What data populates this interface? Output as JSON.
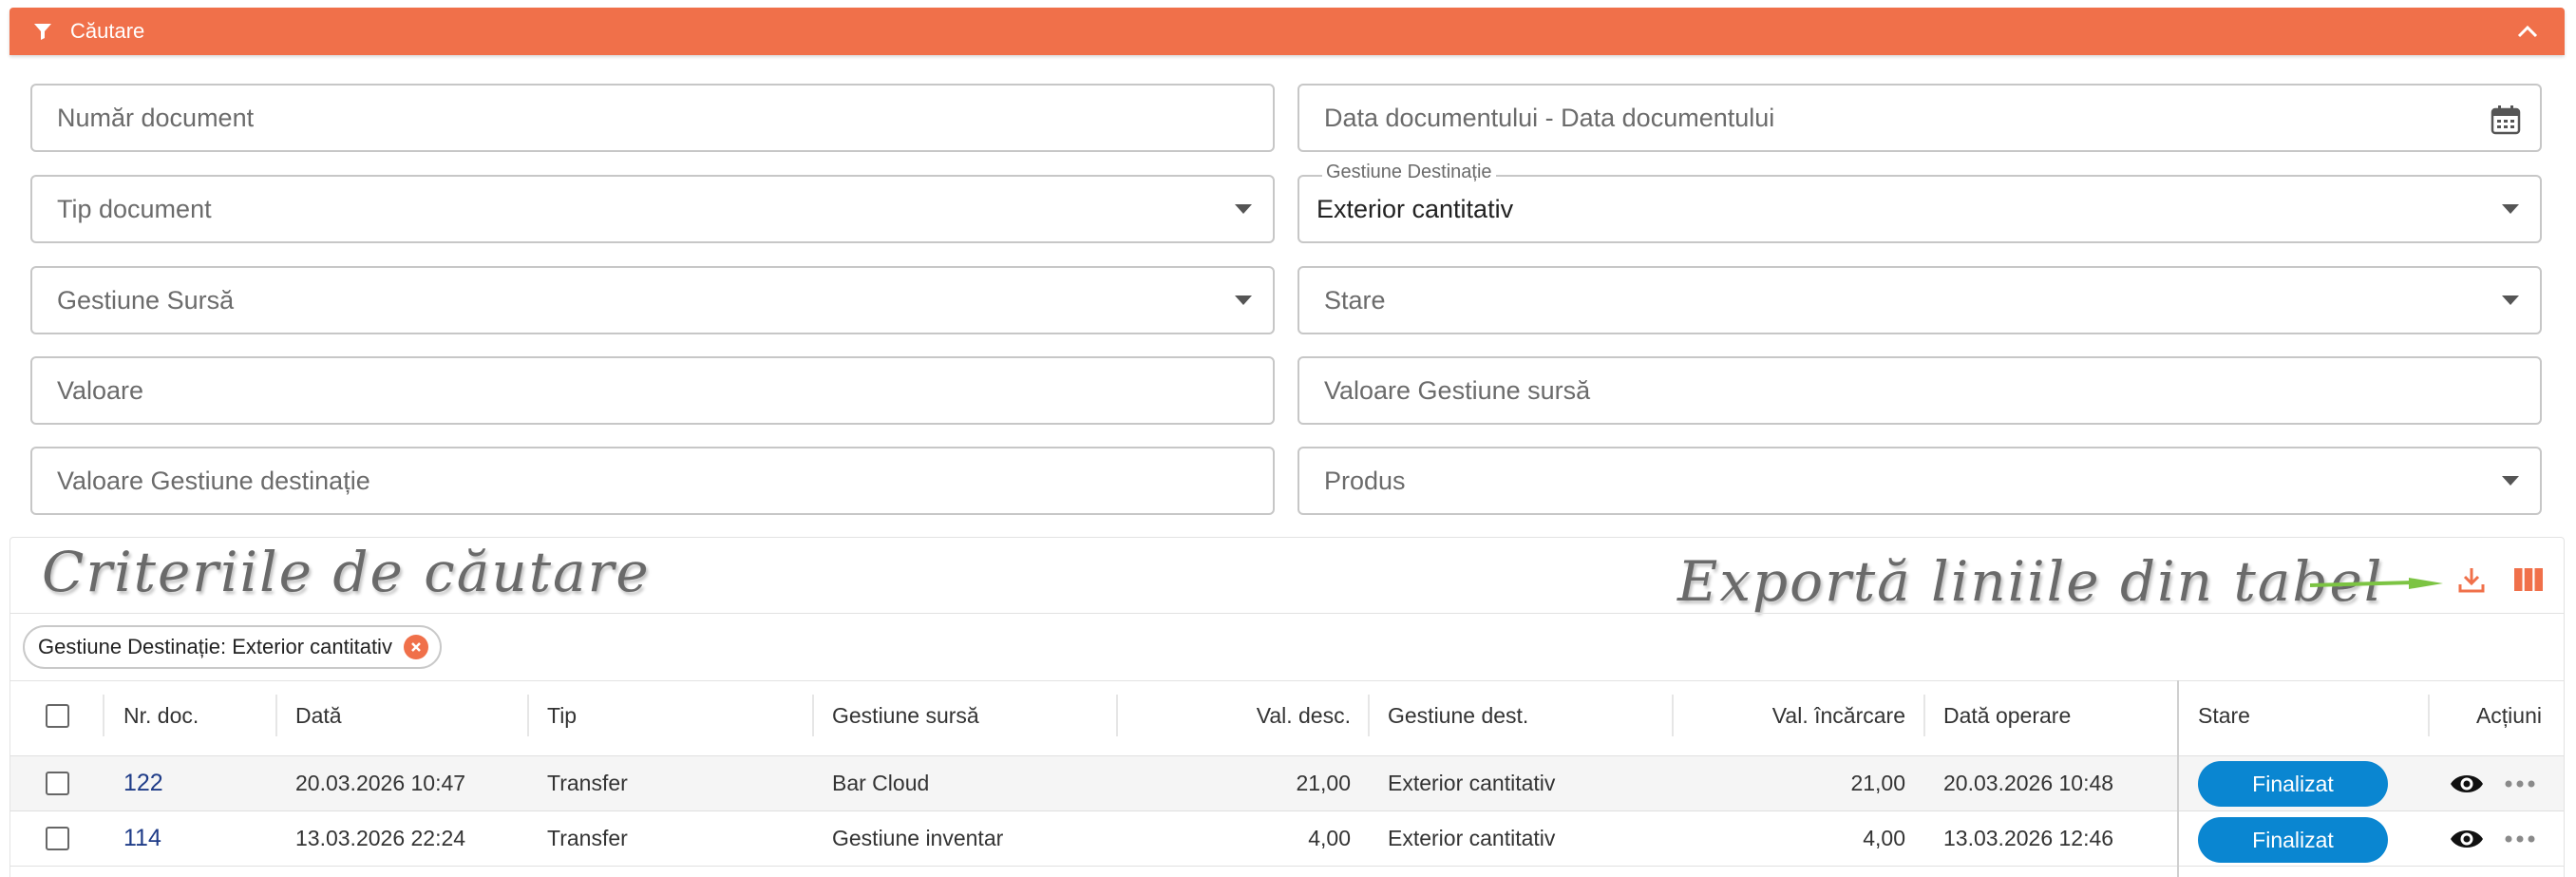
{
  "header": {
    "title": "Căutare"
  },
  "fields": {
    "numar_document": "Număr document",
    "data_documentului": "Data documentului - Data documentului",
    "tip_document": "Tip document",
    "gestiune_destinatie_label": "Gestiune Destinație",
    "gestiune_destinatie_value": "Exterior cantitativ",
    "gestiune_sursa": "Gestiune Sursă",
    "stare": "Stare",
    "valoare": "Valoare",
    "valoare_gestiune_sursa": "Valoare Gestiune sursă",
    "valoare_gestiune_destinatie": "Valoare Gestiune destinație",
    "produs": "Produs"
  },
  "annotations": {
    "criteria": "Criteriile de căutare",
    "export": "Exportă liniile din tabel"
  },
  "chip": {
    "label": "Gestiune Destinație: Exterior cantitativ"
  },
  "table": {
    "headers": {
      "nr_doc": "Nr. doc.",
      "data": "Dată",
      "tip": "Tip",
      "gestiune_sursa": "Gestiune sursă",
      "val_desc": "Val. desc.",
      "gestiune_dest": "Gestiune dest.",
      "val_incarcare": "Val. încărcare",
      "data_operare": "Dată operare",
      "stare": "Stare",
      "actiuni": "Acțiuni"
    },
    "rows": [
      {
        "nr_doc": "122",
        "data": "20.03.2026 10:47",
        "tip": "Transfer",
        "gestiune_sursa": "Bar Cloud",
        "val_desc": "21,00",
        "gestiune_dest": "Exterior cantitativ",
        "val_incarcare": "21,00",
        "data_operare": "20.03.2026 10:48",
        "stare": "Finalizat"
      },
      {
        "nr_doc": "114",
        "data": "13.03.2026 22:24",
        "tip": "Transfer",
        "gestiune_sursa": "Gestiune inventar",
        "val_desc": "4,00",
        "gestiune_dest": "Exterior cantitativ",
        "val_incarcare": "4,00",
        "data_operare": "13.03.2026 12:46",
        "stare": "Finalizat"
      }
    ]
  },
  "colors": {
    "header_orange": "#f0704a",
    "status_blue": "#0a86d1",
    "link_blue": "#1f3c88",
    "arrow_green": "#7cc443"
  },
  "icons": [
    "filter-icon",
    "chevron-up-icon",
    "calendar-icon",
    "chevron-down-icon",
    "download-icon",
    "columns-icon",
    "close-icon",
    "eye-icon",
    "more-horizontal-icon"
  ]
}
